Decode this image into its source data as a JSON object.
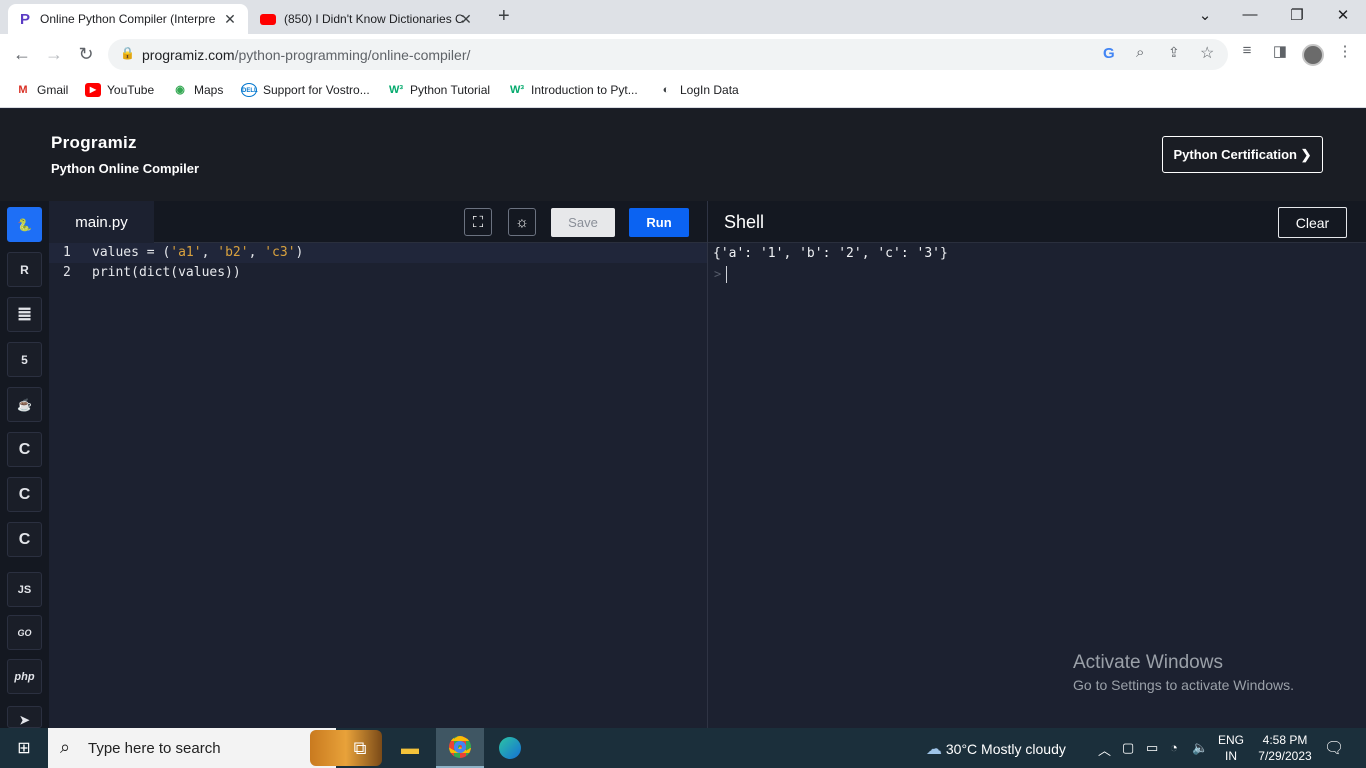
{
  "browser": {
    "tabs": [
      {
        "title": "Online Python Compiler (Interpre",
        "close": "✕"
      },
      {
        "title": "(850) I Didn't Know Dictionaries C",
        "close": "✕"
      }
    ],
    "new_tab": "+",
    "url_host": "programiz.com",
    "url_path": "/python-programming/online-compiler/",
    "bookmarks": [
      {
        "label": "Gmail",
        "icon": "gmail-icon"
      },
      {
        "label": "YouTube",
        "icon": "youtube-icon"
      },
      {
        "label": "Maps",
        "icon": "maps-icon"
      },
      {
        "label": "Support for Vostro...",
        "icon": "dell-icon"
      },
      {
        "label": "Python Tutorial",
        "icon": "w3-icon"
      },
      {
        "label": "Introduction to Pyt...",
        "icon": "w3-icon"
      },
      {
        "label": "LogIn Data",
        "icon": "globe-icon"
      }
    ]
  },
  "site": {
    "logo": "Programiz",
    "subtitle": "Python Online Compiler",
    "cert_button": "Python Certification ❯"
  },
  "sidebar": {
    "languages": [
      {
        "name": "python",
        "glyph": "🐍",
        "active": true
      },
      {
        "name": "r",
        "glyph": "R"
      },
      {
        "name": "sql",
        "glyph": "≣"
      },
      {
        "name": "html",
        "glyph": "5"
      },
      {
        "name": "java",
        "glyph": "☕"
      },
      {
        "name": "c",
        "glyph": "C"
      },
      {
        "name": "cpp",
        "glyph": "C"
      },
      {
        "name": "csharp",
        "glyph": "C"
      },
      {
        "name": "js",
        "glyph": "JS"
      },
      {
        "name": "go",
        "glyph": "GO"
      },
      {
        "name": "php",
        "glyph": "php"
      },
      {
        "name": "swift",
        "glyph": "➤"
      }
    ]
  },
  "editor": {
    "filename": "main.py",
    "save_label": "Save",
    "run_label": "Run",
    "lines": [
      {
        "num": "1",
        "code": "values = ('a1', 'b2', 'c3')"
      },
      {
        "num": "2",
        "code": "print(dict(values))"
      }
    ]
  },
  "shell": {
    "title": "Shell",
    "clear_label": "Clear",
    "output": "{'a': '1', 'b': '2', 'c': '3'}",
    "prompt": ">"
  },
  "watermark": {
    "line1": "Activate Windows",
    "line2": "Go to Settings to activate Windows."
  },
  "taskbar": {
    "search_placeholder": "Type here to search",
    "weather": "30°C  Mostly cloudy",
    "lang_top": "ENG",
    "lang_bottom": "IN",
    "time": "4:58 PM",
    "date": "7/29/2023"
  }
}
